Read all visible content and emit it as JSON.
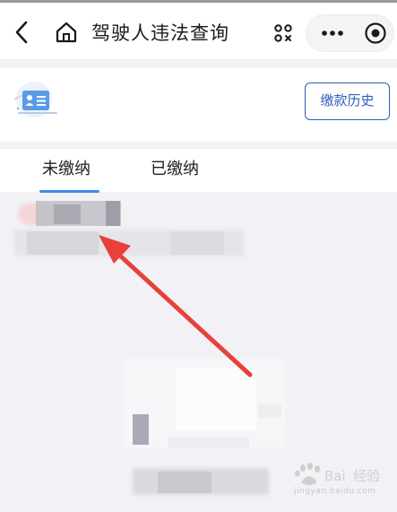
{
  "topbar": {
    "title": "驾驶人违法查询",
    "icons": {
      "back": "chevron-left-icon",
      "home": "home-icon",
      "scan": "scan-icon",
      "more": "more-dots-icon",
      "close": "close-miniprogram-icon"
    }
  },
  "card": {
    "history_button_label": "缴款历史",
    "icon": "driver-license-icon"
  },
  "tabs": [
    {
      "label": "未缴纳",
      "active": true
    },
    {
      "label": "已缴纳",
      "active": false
    }
  ],
  "colors": {
    "accent": "#3a8ee6",
    "history_border": "#2f5fb8",
    "arrow": "#e8403a",
    "background": "#f2f2f6"
  },
  "watermark": {
    "text": "jingyan.baidu.com"
  }
}
